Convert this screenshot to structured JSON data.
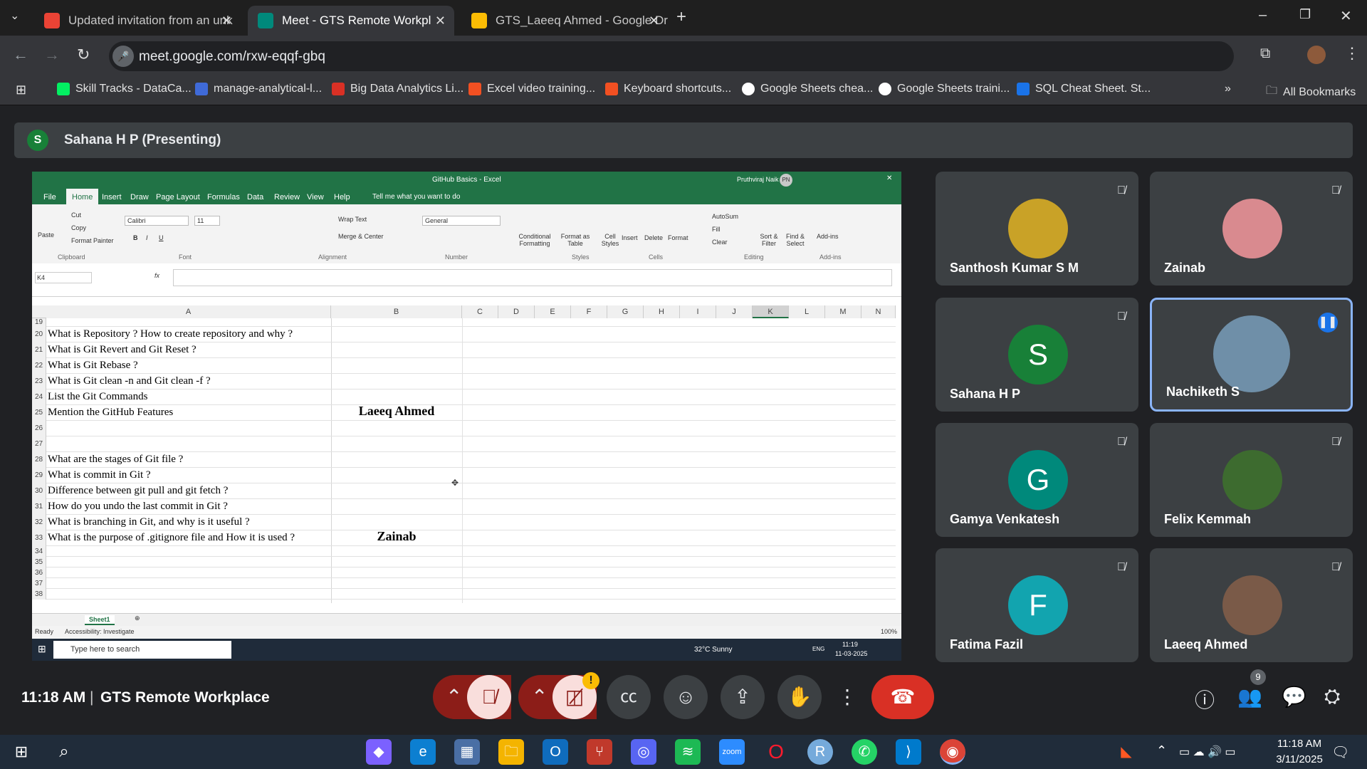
{
  "browser": {
    "tabs": [
      {
        "title": "Updated invitation from an unk",
        "active": false,
        "color": "#ea4335"
      },
      {
        "title": "Meet - GTS Remote Workpl",
        "active": true,
        "color": "#00897b"
      },
      {
        "title": "GTS_Laeeq Ahmed - Google Dr",
        "active": false,
        "color": "#fbbc04"
      }
    ],
    "url": "meet.google.com/rxw-eqqf-gbq",
    "bookmarks": [
      "Skill Tracks - DataCa...",
      "manage-analytical-l...",
      "Big Data Analytics Li...",
      "Excel video training...",
      "Keyboard shortcuts...",
      "Google Sheets chea...",
      "Google Sheets traini...",
      "SQL Cheat Sheet. St..."
    ],
    "all_bookmarks": "All Bookmarks"
  },
  "meet": {
    "presenter": "Sahana H P (Presenting)",
    "presenter_initial": "S",
    "time": "11:18 AM",
    "meeting_name": "GTS Remote Workplace",
    "people_count": "9",
    "participants": [
      {
        "name": "Santhosh Kumar S M",
        "initial": "",
        "color": "#c9a227",
        "photo": true
      },
      {
        "name": "Zainab",
        "initial": "",
        "color": "#d98a8f",
        "photo": true
      },
      {
        "name": "Sahana H P",
        "initial": "S",
        "color": "#188038"
      },
      {
        "name": "Nachiketh S",
        "initial": "",
        "color": "#6f8fa8",
        "photo": true,
        "speaking": true
      },
      {
        "name": "Gamya Venkatesh",
        "initial": "G",
        "color": "#00897b"
      },
      {
        "name": "Felix Kemmah",
        "initial": "",
        "color": "#3d6b2f",
        "photo": true
      },
      {
        "name": "Fatima Fazil",
        "initial": "F",
        "color": "#12a4af"
      },
      {
        "name": "Laeeq Ahmed",
        "initial": "",
        "color": "#7a5a48",
        "photo": true
      }
    ]
  },
  "excel": {
    "title": "GitHub Basics - Excel",
    "user": "Pruthviraj Naik",
    "user_initials": "PN",
    "menu": [
      "File",
      "Home",
      "Insert",
      "Draw",
      "Page Layout",
      "Formulas",
      "Data",
      "Review",
      "View",
      "Help",
      "Tell me what you want to do"
    ],
    "ribbon": {
      "cut": "Cut",
      "copy": "Copy",
      "format_painter": "Format Painter",
      "paste": "Paste",
      "clipboard": "Clipboard",
      "font_name": "Calibri",
      "font_size": "11",
      "font": "Font",
      "wrap": "Wrap Text",
      "merge": "Merge & Center",
      "alignment": "Alignment",
      "number_format": "General",
      "number": "Number",
      "conditional": "Conditional Formatting",
      "format_table": "Format as Table",
      "cell_styles": "Cell Styles",
      "styles": "Styles",
      "insert": "Insert",
      "delete": "Delete",
      "format": "Format",
      "cells": "Cells",
      "autosum": "AutoSum",
      "fill": "Fill",
      "clear": "Clear",
      "sort": "Sort & Filter",
      "find": "Find & Select",
      "editing": "Editing",
      "addins": "Add-ins",
      "addins_group": "Add-ins"
    },
    "name_box": "K4",
    "columns": [
      "A",
      "B",
      "C",
      "D",
      "E",
      "F",
      "G",
      "H",
      "I",
      "J",
      "K",
      "L",
      "M",
      "N"
    ],
    "rows": [
      {
        "n": "19",
        "a": "",
        "b": ""
      },
      {
        "n": "20",
        "a": "What is Repository ? How to create repository and why ?",
        "b": ""
      },
      {
        "n": "21",
        "a": "What is Git Revert and Git Reset ?",
        "b": ""
      },
      {
        "n": "22",
        "a": "What is Git Rebase ?",
        "b": ""
      },
      {
        "n": "23",
        "a": "What is Git clean -n and Git clean -f ?",
        "b": ""
      },
      {
        "n": "24",
        "a": "List the Git Commands",
        "b": ""
      },
      {
        "n": "25",
        "a": "Mention the GitHub Features",
        "b": "Laeeq Ahmed"
      },
      {
        "n": "26",
        "a": "",
        "b": ""
      },
      {
        "n": "27",
        "a": "",
        "b": ""
      },
      {
        "n": "28",
        "a": "What are the stages of Git file ?",
        "b": ""
      },
      {
        "n": "29",
        "a": "What is commit in Git ?",
        "b": ""
      },
      {
        "n": "30",
        "a": "Difference between git pull and git fetch ?",
        "b": ""
      },
      {
        "n": "31",
        "a": "How do you undo the last commit in Git ?",
        "b": ""
      },
      {
        "n": "32",
        "a": "What is branching in Git, and why is it useful ?",
        "b": ""
      },
      {
        "n": "33",
        "a": "What is the purpose of .gitignore file and How it is used ?",
        "b": "Zainab"
      },
      {
        "n": "34",
        "a": "",
        "b": ""
      },
      {
        "n": "35",
        "a": "",
        "b": ""
      },
      {
        "n": "36",
        "a": "",
        "b": ""
      },
      {
        "n": "37",
        "a": "",
        "b": ""
      },
      {
        "n": "38",
        "a": "",
        "b": ""
      }
    ],
    "sheet": "Sheet1",
    "status": "Ready",
    "accessibility": "Accessibility: Investigate",
    "zoom": "100%",
    "inner_taskbar": {
      "search": "Type here to search",
      "weather": "32°C Sunny",
      "lang": "ENG",
      "time": "11:19",
      "date": "11-03-2025"
    }
  },
  "taskbar": {
    "time": "11:18 AM",
    "date": "3/11/2025"
  }
}
